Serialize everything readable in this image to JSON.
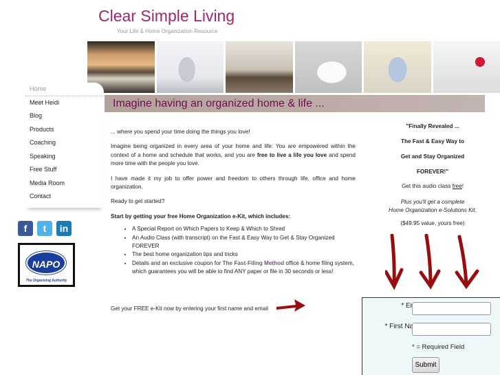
{
  "header": {
    "title": "Clear Simple Living",
    "tagline": "Your Life & Home Organization Resource"
  },
  "banner": "Imagine having an organized home & life ...",
  "nav": [
    "Home",
    "Meet Heidi",
    "Blog",
    "Products",
    "Coaching",
    "Speaking",
    "Free Stuff",
    "Media Room",
    "Contact"
  ],
  "social": [
    {
      "icon": "facebook-icon",
      "label": "f",
      "color": "#3b5998"
    },
    {
      "icon": "twitter-icon",
      "label": "t",
      "color": "#4fb3e8"
    },
    {
      "icon": "linkedin-icon",
      "label": "in",
      "color": "#1a7bb9"
    }
  ],
  "napo": {
    "name": "NAPO",
    "tagline": "The Organizing Authority"
  },
  "main": {
    "p1": "... where you spend your time doing the things you love!",
    "p2a": "Imagine being organized in every area of your home and life: You are empowered within the context of a home and schedule that works, and you are ",
    "p2b": "free to live a life you love",
    "p2c": " and spend more time with the people you love.",
    "p3": "I have made it my job to offer power and freedom to others through life, office and home organization.",
    "p4": "Ready to get started?",
    "p5": "Start by getting your free Home Organization e-Kit, which includes:",
    "bullets": [
      "A Special Report on Which Papers to Keep & Which to Shred",
      "An Audio Class (with transcript) on the Fast & Easy Way to Get & Stay Organized FOREVER",
      "The best home organization tips and tricks"
    ],
    "b4a": "Details and an exclusive coupon for ",
    "b4link": "The Fast-Filing Method",
    "b4b": " office & home filing system, which guarantees you will be able to find ANY paper or file in 30 seconds or less!",
    "cta": "Get your FREE e-Kit now by entering your first name and email"
  },
  "side": {
    "h1": "\"Finally Revealed ...",
    "h2": "The Fast & Easy Way to",
    "h3": "Get and Stay Organized",
    "h4": "FOREVER!\"",
    "audio": "Get this audio class ",
    "free": "free",
    "excl": "!",
    "plus1": "Plus you'll get a complete",
    "plus2": "Home Organization e-Solutions Kit.",
    "value": "($49.95 value, yours free)"
  },
  "form": {
    "email_label": "* Email",
    "name_label": "* First Name",
    "email_value": "",
    "name_value": "",
    "required": "* = Required Field",
    "submit": "Submit"
  },
  "colors": {
    "brand": "#a3246f",
    "banner": "#b3a19c",
    "arrows": "#9b0d0d",
    "form_bg": "#eef8fb"
  }
}
